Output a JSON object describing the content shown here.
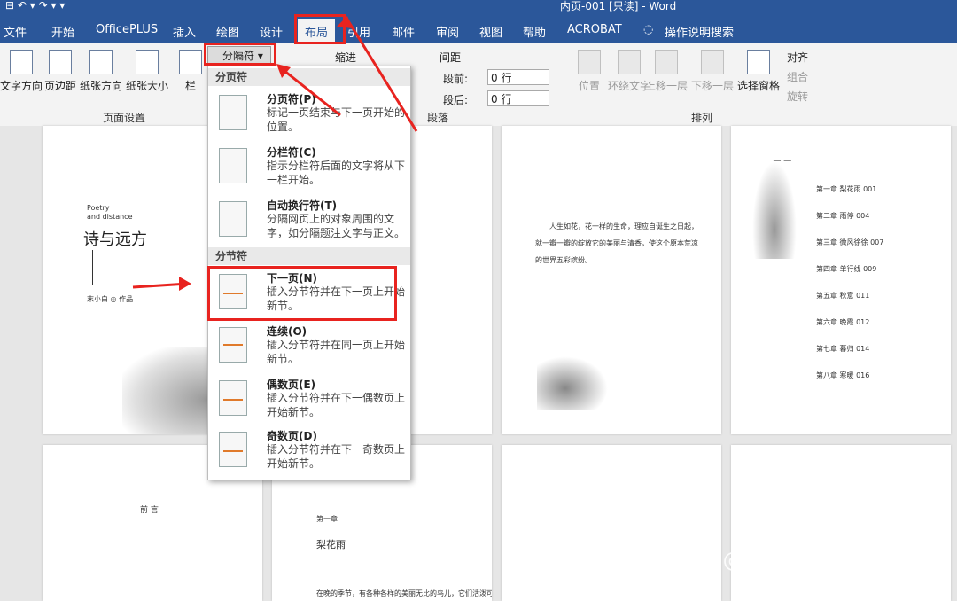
{
  "window": {
    "title": "内页-001 [只读] - Word",
    "quick_access": "⊟ ↶ ▾ ↷ ▾ ▾"
  },
  "tabs": [
    "文件",
    "开始",
    "OfficePLUS",
    "插入",
    "绘图",
    "设计",
    "布局",
    "引用",
    "邮件",
    "审阅",
    "视图",
    "帮助",
    "ACROBAT",
    "操作说明搜索"
  ],
  "active_tab": "布局",
  "tell_me_icon": "lightbulb-icon",
  "ribbon": {
    "page_setup": {
      "label": "页面设置",
      "buttons": [
        "文字方向",
        "页边距",
        "纸张方向",
        "纸张大小",
        "栏"
      ],
      "breaks_button": "分隔符"
    },
    "paragraph": {
      "label": "段落",
      "indent_label": "缩进",
      "spacing_label": "间距",
      "before_label": "段前:",
      "before_value": "0 行",
      "after_label": "段后:",
      "after_value": "0 行"
    },
    "arrange": {
      "label": "排列",
      "buttons": [
        "位置",
        "环绕文字",
        "上移一层",
        "下移一层",
        "选择窗格"
      ],
      "align": "对齐",
      "group": "组合",
      "rotate": "旋转"
    }
  },
  "breaks_menu": {
    "section1": "分页符",
    "section2": "分节符",
    "items": [
      {
        "title": "分页符(P)",
        "desc": "标记一页结束与下一页开始的位置。"
      },
      {
        "title": "分栏符(C)",
        "desc": "指示分栏符后面的文字将从下一栏开始。"
      },
      {
        "title": "自动换行符(T)",
        "desc": "分隔网页上的对象周围的文字，如分隔题注文字与正文。"
      },
      {
        "title": "下一页(N)",
        "desc": "插入分节符并在下一页上开始新节。"
      },
      {
        "title": "连续(O)",
        "desc": "插入分节符并在同一页上开始新节。"
      },
      {
        "title": "偶数页(E)",
        "desc": "插入分节符并在下一偶数页上开始新节。"
      },
      {
        "title": "奇数页(D)",
        "desc": "插入分节符并在下一奇数页上开始新节。"
      }
    ]
  },
  "pages": {
    "cover_small1": "Poetry",
    "cover_small2": "and distance",
    "cover_title": "诗与远方",
    "cover_author": "末小白 ◎ 作品",
    "p3_line1": "人生如花，花一样的生命，理应自诞生之日起，",
    "p3_line2": "就一瓣一瓣的绽放它的美丽与清香，使这个原本荒凉",
    "p3_line3": "的世界五彩缤纷。",
    "toc_title": "目录",
    "toc": [
      "第一章 梨花雨 001",
      "第二章 雨停 004",
      "第三章 微风徐徐 007",
      "第四章 单行线 009",
      "第五章 秋意 011",
      "第六章 晚霞 012",
      "第七章 暮归 014",
      "第八章 寒暖 016"
    ],
    "preface": "前 言",
    "chapter1": "第一章",
    "chapter1_title": "梨花雨",
    "body_snippet": "在晚的季节，有各种各样的美丽无比的鸟儿，它们活泼可"
  },
  "watermark": "知乎 @星河设计学"
}
